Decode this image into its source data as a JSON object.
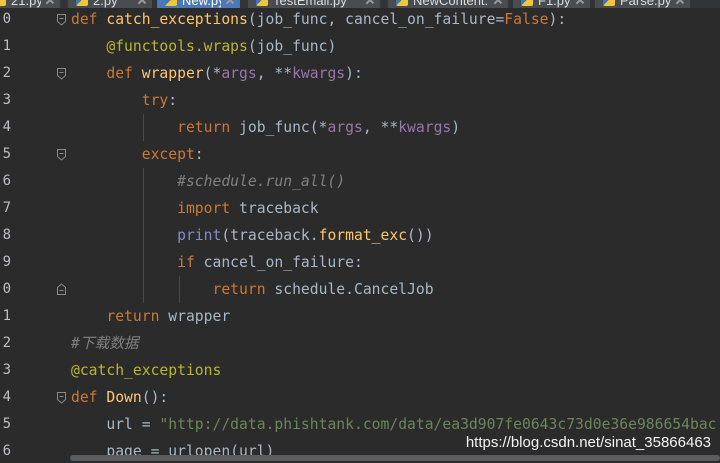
{
  "tabs": [
    {
      "label": "21.py",
      "active": false,
      "icon": "python-file-icon"
    },
    {
      "label": "2.py",
      "active": false,
      "icon": "python-file-icon"
    },
    {
      "label": "New.py",
      "active": true,
      "icon": "python-file-icon"
    },
    {
      "label": "TestEmail.py",
      "active": false,
      "icon": "python-file-icon"
    },
    {
      "label": "NewContent.py",
      "active": false,
      "icon": "python-file-icon"
    },
    {
      "label": "F1.py",
      "active": false,
      "icon": "python-file-icon"
    },
    {
      "label": "Parse.py",
      "active": false,
      "icon": "python-file-icon"
    }
  ],
  "theme": {
    "editor_background": "#2b2b2b",
    "active_tab": "#4a78b8",
    "line_number": "#bcbec1",
    "fold_icon": "#8a8a8a"
  },
  "syntax_colors": {
    "plain": "#a9b7c6",
    "keyword": "#cc7832",
    "function": "#ffc66d",
    "decorator": "#bbb529",
    "parameter": "#9876aa",
    "builtin": "#8888c6",
    "string": "#6a8759",
    "comment": "#808080"
  },
  "code": {
    "lines": [
      {
        "number": "0",
        "fold_icon": "fold-collapse-icon",
        "tokens": [
          {
            "text": "def",
            "color": "#cc7832"
          },
          {
            "text": " ",
            "color": "#a9b7c6"
          },
          {
            "text": "catch_exceptions",
            "color": "#ffc66d"
          },
          {
            "text": "(job_func, cancel_on_failure=",
            "color": "#a9b7c6"
          },
          {
            "text": "False",
            "color": "#cc7832"
          },
          {
            "text": "):",
            "color": "#a9b7c6"
          }
        ]
      },
      {
        "number": "1",
        "fold_icon": null,
        "tokens": [
          {
            "text": "    @functools.wraps",
            "color": "#bbb529"
          },
          {
            "text": "(job_func)",
            "color": "#a9b7c6"
          }
        ]
      },
      {
        "number": "2",
        "fold_icon": "fold-collapse-icon",
        "tokens": [
          {
            "text": "    def",
            "color": "#cc7832"
          },
          {
            "text": " ",
            "color": "#a9b7c6"
          },
          {
            "text": "wrapper",
            "color": "#ffc66d"
          },
          {
            "text": "(*",
            "color": "#a9b7c6"
          },
          {
            "text": "args",
            "color": "#9876aa"
          },
          {
            "text": ", **",
            "color": "#a9b7c6"
          },
          {
            "text": "kwargs",
            "color": "#9876aa"
          },
          {
            "text": "):",
            "color": "#a9b7c6"
          }
        ]
      },
      {
        "number": "3",
        "fold_icon": null,
        "tokens": [
          {
            "text": "        try",
            "color": "#cc7832"
          },
          {
            "text": ":",
            "color": "#a9b7c6"
          }
        ]
      },
      {
        "number": "4",
        "fold_icon": null,
        "tokens": [
          {
            "text": "            return",
            "color": "#cc7832"
          },
          {
            "text": " job_func(*",
            "color": "#a9b7c6"
          },
          {
            "text": "args",
            "color": "#9876aa"
          },
          {
            "text": ", **",
            "color": "#a9b7c6"
          },
          {
            "text": "kwargs",
            "color": "#9876aa"
          },
          {
            "text": ")",
            "color": "#a9b7c6"
          }
        ]
      },
      {
        "number": "5",
        "fold_icon": "fold-collapse-icon",
        "tokens": [
          {
            "text": "        except",
            "color": "#cc7832"
          },
          {
            "text": ":",
            "color": "#a9b7c6"
          }
        ]
      },
      {
        "number": "6",
        "fold_icon": null,
        "tokens": [
          {
            "text": "            #schedule.run_all()",
            "color": "#808080"
          }
        ]
      },
      {
        "number": "7",
        "fold_icon": null,
        "tokens": [
          {
            "text": "            import",
            "color": "#cc7832"
          },
          {
            "text": " traceback",
            "color": "#a9b7c6"
          }
        ]
      },
      {
        "number": "8",
        "fold_icon": null,
        "tokens": [
          {
            "text": "            print",
            "color": "#8888c6"
          },
          {
            "text": "(traceback.",
            "color": "#a9b7c6"
          },
          {
            "text": "format_exc",
            "color": "#ffc66d"
          },
          {
            "text": "())",
            "color": "#a9b7c6"
          }
        ]
      },
      {
        "number": "9",
        "fold_icon": null,
        "tokens": [
          {
            "text": "            if",
            "color": "#cc7832"
          },
          {
            "text": " cancel_on_failure:",
            "color": "#a9b7c6"
          }
        ]
      },
      {
        "number": "0",
        "fold_icon": "fold-end-icon",
        "tokens": [
          {
            "text": "                return",
            "color": "#cc7832"
          },
          {
            "text": " schedule.CancelJob",
            "color": "#a9b7c6"
          }
        ]
      },
      {
        "number": "1",
        "fold_icon": null,
        "tokens": [
          {
            "text": "    return",
            "color": "#cc7832"
          },
          {
            "text": " wrapper",
            "color": "#a9b7c6"
          }
        ]
      },
      {
        "number": "2",
        "fold_icon": null,
        "tokens": [
          {
            "text": "#下载数据",
            "color": "#808080"
          }
        ]
      },
      {
        "number": "3",
        "fold_icon": null,
        "tokens": [
          {
            "text": "@catch_exceptions",
            "color": "#bbb529"
          }
        ]
      },
      {
        "number": "4",
        "fold_icon": "fold-collapse-icon",
        "tokens": [
          {
            "text": "def",
            "color": "#cc7832"
          },
          {
            "text": " ",
            "color": "#a9b7c6"
          },
          {
            "text": "Down",
            "color": "#ffc66d"
          },
          {
            "text": "():",
            "color": "#a9b7c6"
          }
        ]
      },
      {
        "number": "5",
        "fold_icon": null,
        "tokens": [
          {
            "text": "    url = ",
            "color": "#a9b7c6"
          },
          {
            "text": "\"http://data.phishtank.com/data/ea3d907fe0643c73d0e36e986654bac",
            "color": "#6a8759"
          }
        ]
      },
      {
        "number": "6",
        "fold_icon": null,
        "tokens": [
          {
            "text": "    page = urlopen(url)",
            "color": "#a9b7c6"
          }
        ]
      }
    ]
  },
  "watermark": "https://blog.csdn.net/sinat_35866463"
}
